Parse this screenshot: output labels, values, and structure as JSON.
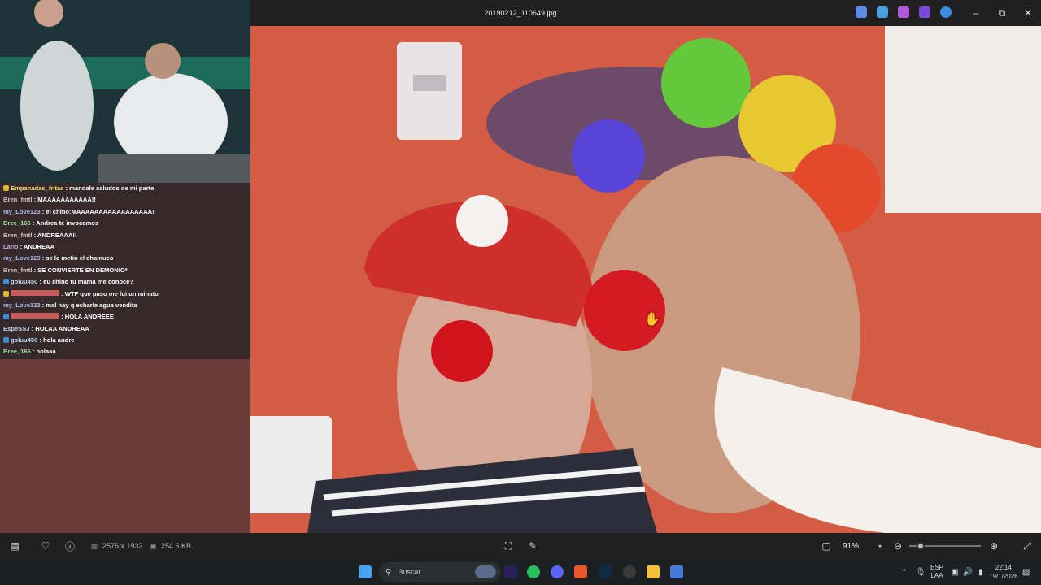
{
  "window": {
    "title": "20190212_110649.jpg",
    "controls": [
      "minimize-icon",
      "maximize-icon",
      "close-icon"
    ]
  },
  "header_apps": [
    {
      "icon": "copilot-icon",
      "color": "#5a8de8"
    },
    {
      "icon": "paint-icon",
      "color": "#4a9fe0"
    },
    {
      "icon": "designer-icon",
      "color": "#b05ad8"
    },
    {
      "icon": "clipchamp-icon",
      "color": "#7a4ad8"
    },
    {
      "icon": "onedrive-icon",
      "color": "#3a8fe0"
    }
  ],
  "chat": {
    "messages": [
      {
        "user": "Empanadas_fritas",
        "text": " : mandale saludos de mi parte",
        "user_color": "#f2e26c",
        "badge": "y"
      },
      {
        "user": "Bren_fmtl",
        "text": " : MAAAAAAAAAAA!!",
        "user_color": "#d9c2c2",
        "badge": ""
      },
      {
        "user": "my_Love123",
        "text": " : el chino:MAAAAAAAAAAAAAAAAA!",
        "user_color": "#a9b9e8",
        "badge": ""
      },
      {
        "user": "Bree_166",
        "text": " : Andrea te invocamos",
        "user_color": "#9fe39f",
        "badge": ""
      },
      {
        "user": "Bren_fmtl",
        "text": " : ANDREAAA!!",
        "user_color": "#d9c2c2",
        "badge": ""
      },
      {
        "user": "Lario",
        "text": " : ANDREAA",
        "user_color": "#c9a6e8",
        "badge": ""
      },
      {
        "user": "my_Love123",
        "text": " : se le metio el chamuco",
        "user_color": "#a9b9e8",
        "badge": ""
      },
      {
        "user": "Bren_fmtl",
        "text": " : SE CONVIERTE EN DEMONIO*",
        "user_color": "#d9c2c2",
        "badge": ""
      },
      {
        "user": "goluu450",
        "text": " : eu chino tu mama me conoce?",
        "user_color": "#bcd7f2",
        "badge": "b"
      },
      {
        "user": "",
        "text": " : WTF que paso me fui un minuto",
        "user_color": "#c45c5c",
        "badge": "y"
      },
      {
        "user": "my_Love123",
        "text": " : mal hay q echarle agua vendita",
        "user_color": "#a9b9e8",
        "badge": ""
      },
      {
        "user": "",
        "text": " : HOLA ANDREEE",
        "user_color": "#c45c5c",
        "badge": "b"
      },
      {
        "user": "EspeSSJ",
        "text": " : HOLAA ANDREAA",
        "user_color": "#bcd7f2",
        "badge": ""
      },
      {
        "user": "goluu450",
        "text": " : hola andre",
        "user_color": "#bcd7f2",
        "badge": "b"
      },
      {
        "user": "Bree_166",
        "text": " : holaaa",
        "user_color": "#9fe39f",
        "badge": ""
      }
    ]
  },
  "viewer_toolbar": {
    "dimensions": "2576 x 1932",
    "file_size": "254.6 KB",
    "zoom": "91%",
    "zoom_fraction": 0.16
  },
  "taskbar": {
    "search_placeholder": "Buscar",
    "language_top": "ESP",
    "language_bottom": "LAA",
    "time": "22:14",
    "date": "19/1/2026",
    "apps": [
      {
        "icon": "windows-start-icon",
        "color": "#4aa3f0"
      },
      {
        "icon": "widget-icon",
        "color": "#5c6a8a"
      },
      {
        "icon": "premiere-icon",
        "color": "#2a1f5e"
      },
      {
        "icon": "whatsapp-icon",
        "color": "#25c05a"
      },
      {
        "icon": "discord-icon",
        "color": "#5865f2"
      },
      {
        "icon": "brave-icon",
        "color": "#e8562a"
      },
      {
        "icon": "photoshop-icon",
        "color": "#0e2a45"
      },
      {
        "icon": "obs-icon",
        "color": "#3a3a3a"
      },
      {
        "icon": "file-explorer-icon",
        "color": "#f2c23c"
      },
      {
        "icon": "photos-icon",
        "color": "#4a7ad8"
      }
    ]
  }
}
